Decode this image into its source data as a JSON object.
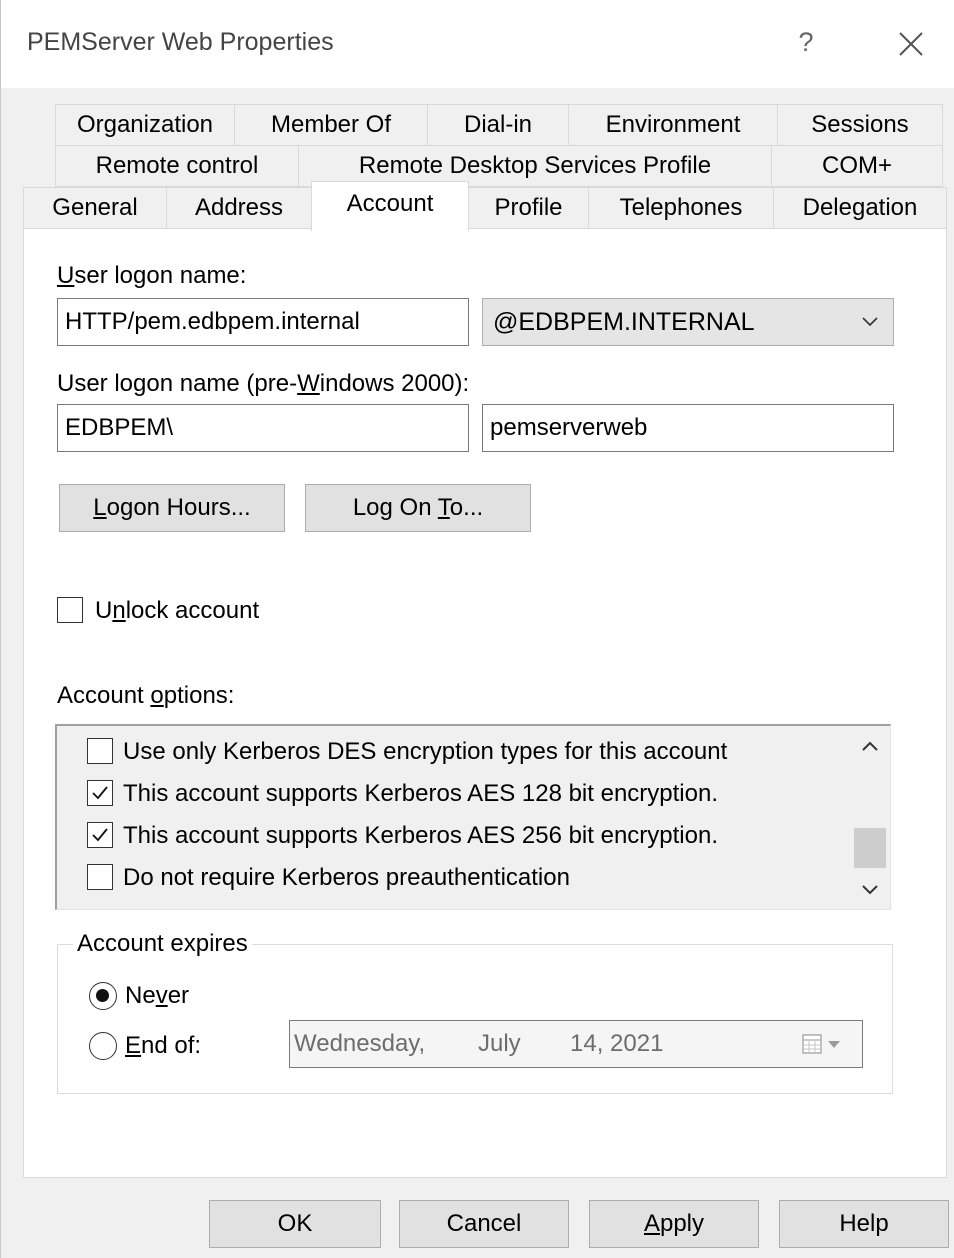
{
  "window": {
    "title": "PEMServer Web Properties",
    "help_glyph": "?"
  },
  "tabs": {
    "row1": [
      "Organization",
      "Member Of",
      "Dial-in",
      "Environment",
      "Sessions"
    ],
    "row2": [
      "Remote control",
      "Remote Desktop Services Profile",
      "COM+"
    ],
    "row3": [
      "General",
      "Address",
      "Account",
      "Profile",
      "Telephones",
      "Delegation"
    ],
    "active": "Account"
  },
  "account": {
    "logon_name_label": {
      "pre": "",
      "accel": "U",
      "post": "ser logon name:"
    },
    "logon_name_value": "HTTP/pem.edbpem.internal",
    "domain_suffix": "@EDBPEM.INTERNAL",
    "prewin_label": {
      "pre": "User logon name (pre-",
      "accel": "W",
      "post": "indows 2000):"
    },
    "prewin_domain": "EDBPEM\\",
    "prewin_user": "pemserverweb",
    "logon_hours_btn": {
      "pre": "",
      "accel": "L",
      "post": "ogon Hours..."
    },
    "logon_to_btn": {
      "pre": "Log On ",
      "accel": "T",
      "post": "o..."
    },
    "unlock_label": {
      "pre": "U",
      "accel": "n",
      "post": "lock account"
    },
    "unlock_checked": false,
    "options_label": {
      "pre": "Account ",
      "accel": "o",
      "post": "ptions:"
    },
    "options": [
      {
        "label": "Use only Kerberos DES encryption types for this account",
        "checked": false
      },
      {
        "label": "This account supports Kerberos AES 128 bit encryption.",
        "checked": true
      },
      {
        "label": "This account supports Kerberos AES 256 bit encryption.",
        "checked": true
      },
      {
        "label": "Do not require Kerberos preauthentication",
        "checked": false
      }
    ],
    "expires_title": "Account expires",
    "never": {
      "pre": "Ne",
      "accel": "v",
      "post": "er",
      "selected": true
    },
    "end_of": {
      "pre": "",
      "accel": "E",
      "post": "nd of:",
      "selected": false
    },
    "date": {
      "weekday": "Wednesday,",
      "month": "July",
      "day_year": "14, 2021"
    }
  },
  "footer": {
    "ok": "OK",
    "cancel": "Cancel",
    "apply": {
      "pre": "",
      "accel": "A",
      "post": "pply"
    },
    "help": "Help"
  },
  "colors": {
    "panel_bg": "#ffffff",
    "client_bg": "#f0f0f0",
    "button_bg": "#e1e1e1",
    "border": "#adadad"
  }
}
